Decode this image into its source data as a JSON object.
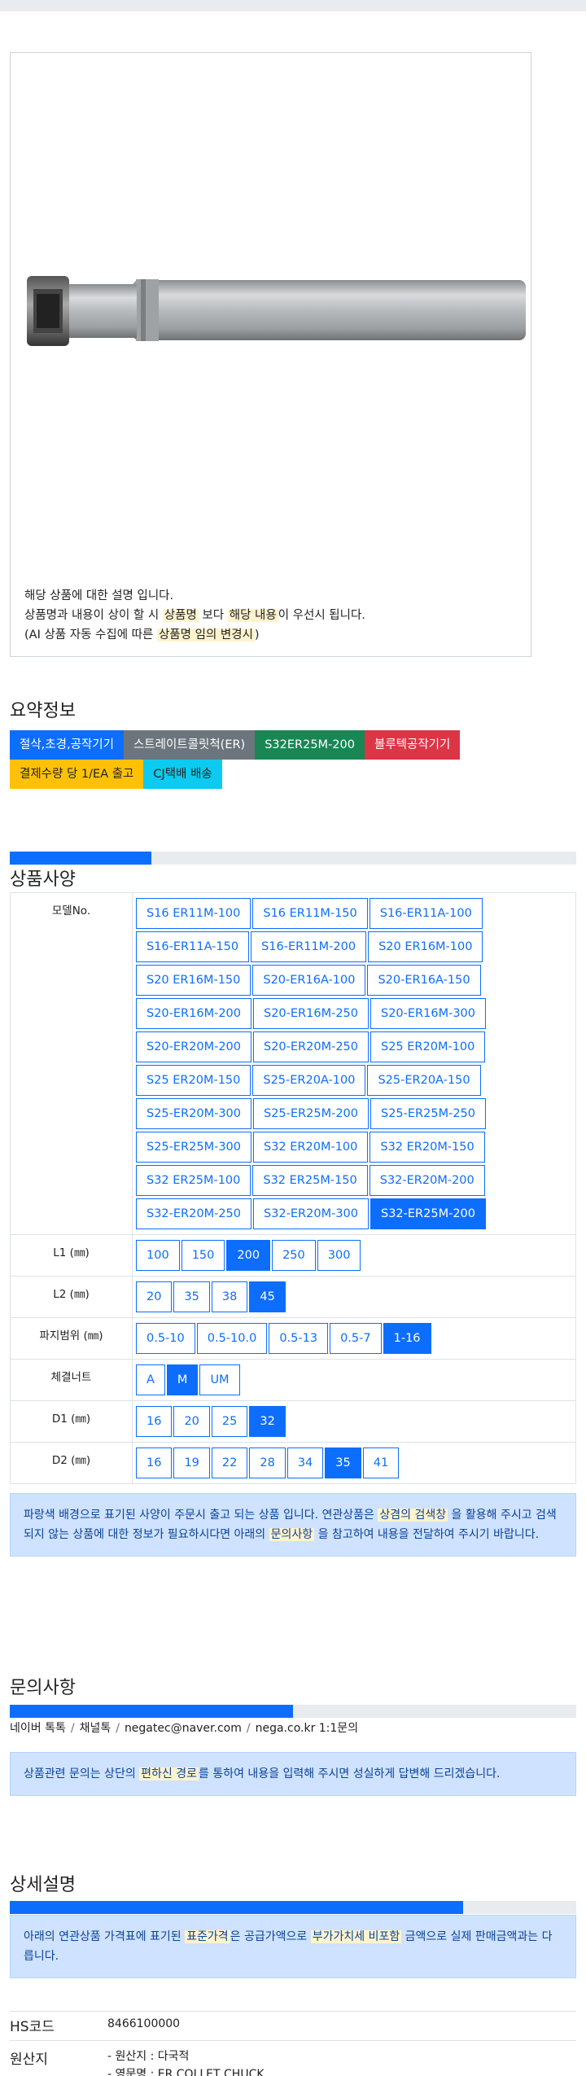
{
  "product_image": {
    "description_lines": [
      {
        "parts": [
          {
            "t": "해당 상품에 대한 설명 입니다."
          }
        ]
      },
      {
        "parts": [
          {
            "t": "상품명과 내용이 상이 할 시 "
          },
          {
            "t": "상품명",
            "hl": true
          },
          {
            "t": " 보다 "
          },
          {
            "t": "해당 내용",
            "hl": true
          },
          {
            "t": "이 우선시 됩니다."
          }
        ]
      },
      {
        "parts": [
          {
            "t": "(AI 상품 자동 수집에 따른 "
          },
          {
            "t": "상품명 임의 변경시",
            "hl": true
          },
          {
            "t": ")"
          }
        ]
      }
    ]
  },
  "summary": {
    "title": "요약정보",
    "badges": [
      {
        "label": "절삭,초경,공작기기",
        "color": "#0d6efd"
      },
      {
        "label": "스트레이트콜릿척(ER)",
        "color": "#6c757d"
      },
      {
        "label": "S32ER25M-200",
        "color": "#198754"
      },
      {
        "label": "볼루텍공작기기",
        "color": "#dc3545"
      },
      {
        "label": "결제수량 당 1/EA 출고",
        "color": "#ffc107",
        "text": "#222"
      },
      {
        "label": "CJ택배 배송",
        "color": "#0dcaf0",
        "text": "#222"
      }
    ]
  },
  "spec": {
    "title": "상품사양",
    "progress": 0.25,
    "rows": [
      {
        "label": "모델No.",
        "selected": "S32-ER25M-200",
        "options": [
          "S16 ER11M-100",
          "S16 ER11M-150",
          "S16-ER11A-100",
          "S16-ER11A-150",
          "S16-ER11M-200",
          "S20 ER16M-100",
          "S20 ER16M-150",
          "S20-ER16A-100",
          "S20-ER16A-150",
          "S20-ER16M-200",
          "S20-ER16M-250",
          "S20-ER16M-300",
          "S20-ER20M-200",
          "S20-ER20M-250",
          "S25 ER20M-100",
          "S25 ER20M-150",
          "S25-ER20A-100",
          "S25-ER20A-150",
          "S25-ER20M-300",
          "S25-ER25M-200",
          "S25-ER25M-250",
          "S25-ER25M-300",
          "S32 ER20M-100",
          "S32 ER20M-150",
          "S32 ER25M-100",
          "S32 ER25M-150",
          "S32-ER20M-200",
          "S32-ER20M-250",
          "S32-ER20M-300",
          "S32-ER25M-200"
        ]
      },
      {
        "label": "L1 (㎜)",
        "selected": "200",
        "options": [
          "100",
          "150",
          "200",
          "250",
          "300"
        ]
      },
      {
        "label": "L2 (㎜)",
        "selected": "45",
        "options": [
          "20",
          "35",
          "38",
          "45"
        ]
      },
      {
        "label": "파지범위 (㎜)",
        "selected": "1-16",
        "options": [
          "0.5-10",
          "0.5-10.0",
          "0.5-13",
          "0.5-7",
          "1-16"
        ]
      },
      {
        "label": "체결너트",
        "selected": "M",
        "options": [
          "A",
          "M",
          "UM"
        ]
      },
      {
        "label": "D1 (㎜)",
        "selected": "32",
        "options": [
          "16",
          "20",
          "25",
          "32"
        ]
      },
      {
        "label": "D2 (㎜)",
        "selected": "35",
        "options": [
          "16",
          "19",
          "22",
          "28",
          "34",
          "35",
          "41"
        ]
      }
    ],
    "notice_parts": [
      {
        "t": "파랑색 배경으로 표기된 사양이 주문시 출고 되는 상품 입니다. 연관상품은 "
      },
      {
        "t": "상겸의 검색창",
        "hl": true
      },
      {
        "t": " 을 활용해 주시고 검색되지 않는 상품에 대한 정보가 필요하시다면 아래의 "
      },
      {
        "t": "문의사항",
        "hl": true
      },
      {
        "t": " 을 참고하여 내용을 전달하여 주시기 바랍니다."
      }
    ]
  },
  "inquiry": {
    "title": "문의사항",
    "progress": 0.5,
    "contacts": [
      "네이버 톡톡",
      "채널톡",
      "negatec@naver.com",
      "nega.co.kr 1:1문의"
    ],
    "notice_parts": [
      {
        "t": "상품관련 문의는 상단의 "
      },
      {
        "t": "편하신 경로",
        "hl": true
      },
      {
        "t": "를 통하여 내용을 입력해 주시면 성실하게 답변해 드리겠습니다."
      }
    ]
  },
  "detail": {
    "title": "상세설명",
    "progress": 0.8,
    "notice_parts": [
      {
        "t": "아래의 연관상품 가격표에 표기된 "
      },
      {
        "t": "표준가격",
        "hl": true
      },
      {
        "t": "은 공급가액으로 "
      },
      {
        "t": "부가가치세 비포함",
        "hl": true
      },
      {
        "t": " 금액으로 실제 판매금액과는 다릅니다."
      }
    ]
  },
  "hs": {
    "code_label": "HS코드",
    "code_value": "8466100000",
    "origin_label": "원산지",
    "origin_lines": [
      "- 원산지 : 다국적",
      "- 영문명 : ER COLLET CHUCK"
    ]
  }
}
